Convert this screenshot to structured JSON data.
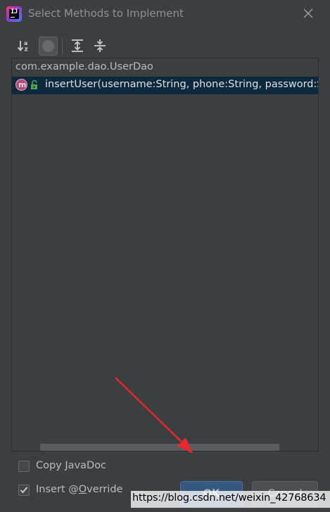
{
  "window": {
    "title": "Select Methods to Implement",
    "app_logo_glyph": "IJ"
  },
  "toolbar": {
    "sort_icon": "sort-alphabetically-icon",
    "toggle_icon": "show-classes-toggle-icon",
    "expand_icon": "expand-all-icon",
    "collapse_icon": "collapse-all-icon"
  },
  "tree": {
    "class_name": "com.example.dao.UserDao",
    "methods": [
      {
        "icon_letter": "m",
        "signature": "insertUser(username:String, phone:String, password:String",
        "selected": true
      }
    ]
  },
  "options": {
    "copy_javadoc": {
      "label_prefix": "Copy ",
      "label_mnemonic": "J",
      "label_rest": "avaDoc",
      "checked": false
    },
    "insert_override": {
      "label_prefix": "Insert @",
      "label_mnemonic": "O",
      "label_rest": "verride",
      "checked": true
    }
  },
  "buttons": {
    "ok_label": "OK",
    "cancel_label": "Cancel"
  },
  "watermark": "https://blog.csdn.net/weixin_42768634",
  "colors": {
    "background": "#3c3f41",
    "selection": "#0d293e",
    "ok_button": "#365880",
    "arrow": "#e8262b",
    "method_icon": "#b04d7c"
  }
}
